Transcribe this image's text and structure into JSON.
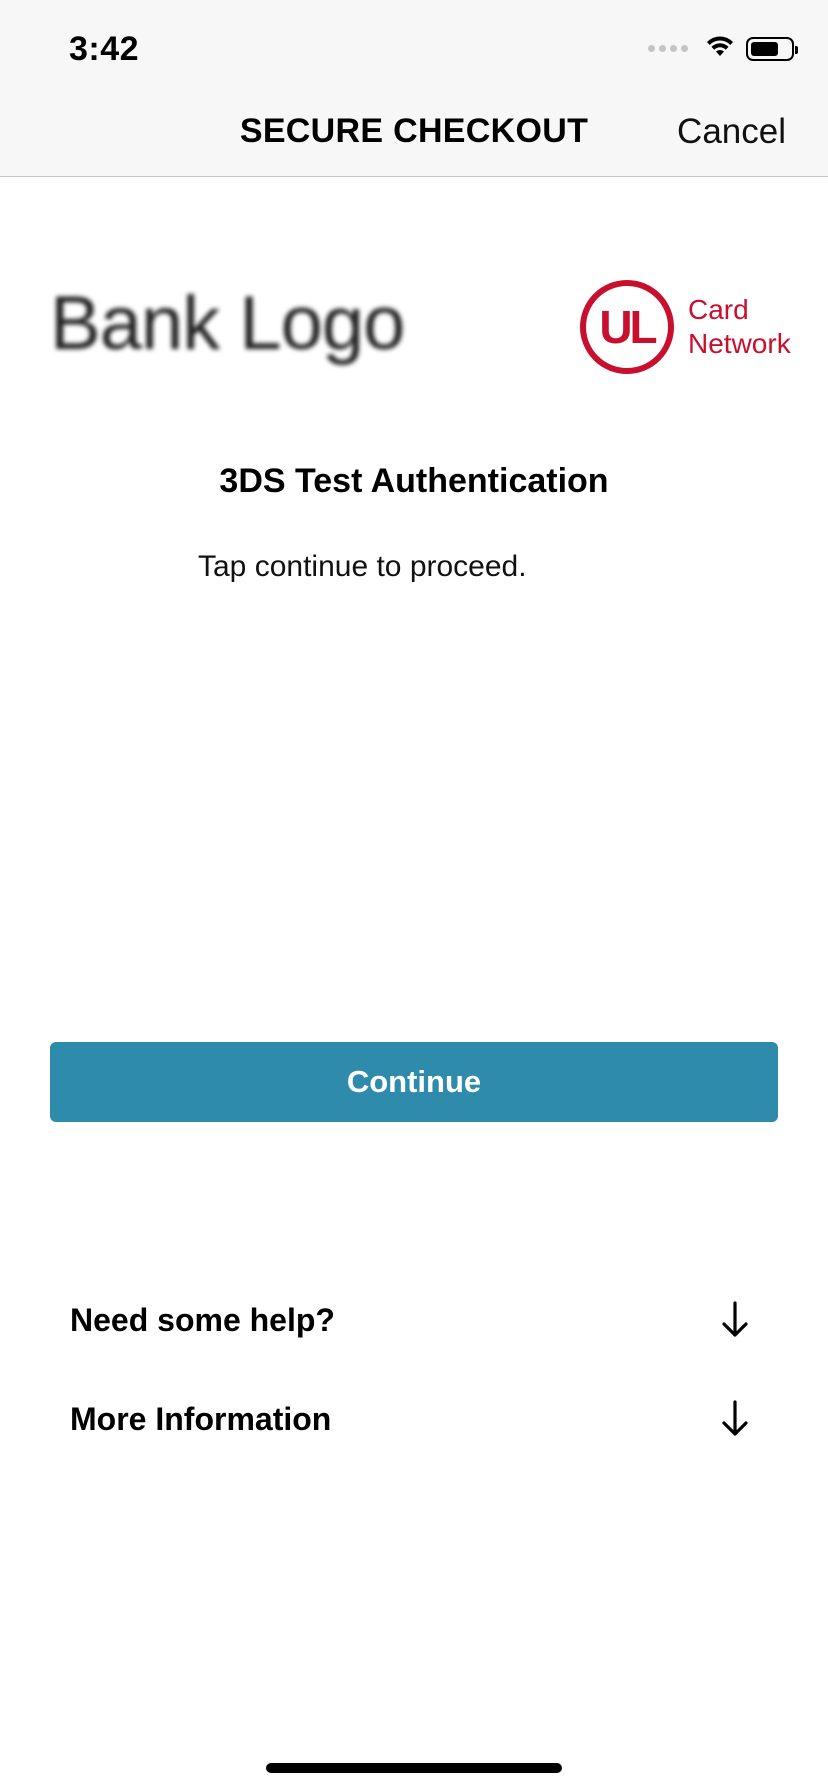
{
  "status_bar": {
    "time": "3:42",
    "icons": [
      "cellular-signal-icon",
      "wifi-icon",
      "battery-icon"
    ],
    "battery_level": 0.7
  },
  "nav": {
    "title": "SECURE CHECKOUT",
    "cancel_label": "Cancel"
  },
  "logos": {
    "bank_logo_text": "Bank Logo",
    "network_mark": "UL",
    "network_name_line1": "Card",
    "network_name_line2": "Network",
    "network_color": "#c8102e"
  },
  "content": {
    "title": "3DS Test Authentication",
    "instruction": "Tap continue to proceed."
  },
  "actions": {
    "continue_label": "Continue",
    "button_color": "#2e8bab"
  },
  "expanders": [
    {
      "label": "Need some help?",
      "icon": "arrow-down-icon"
    },
    {
      "label": "More Information",
      "icon": "arrow-down-icon"
    }
  ]
}
